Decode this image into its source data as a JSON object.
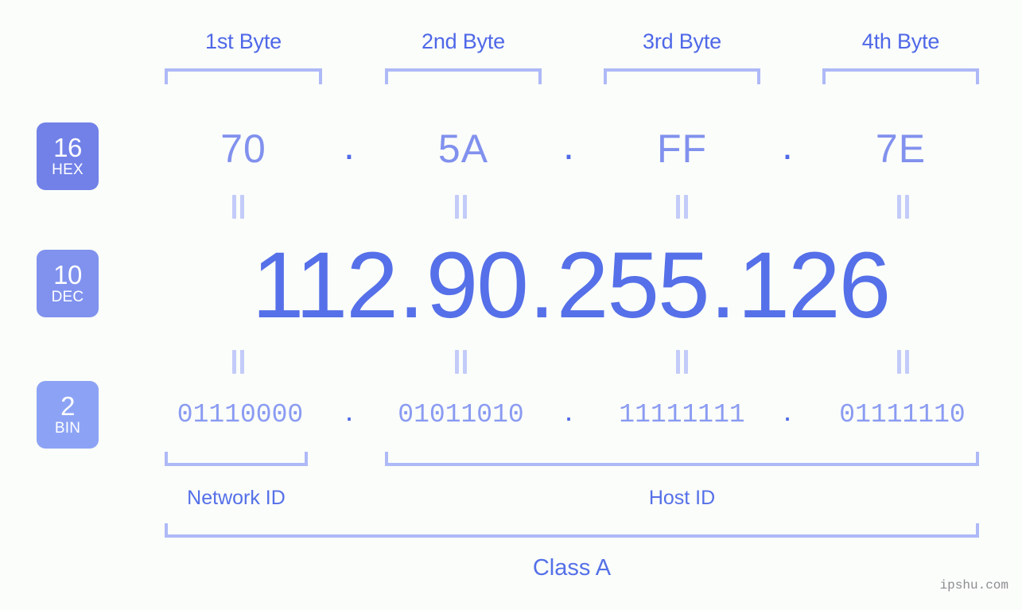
{
  "watermark": "ipshu.com",
  "background_color": "#fbfdfa",
  "colors": {
    "hex_text": "#8191ee",
    "dec_text": "#5570e8",
    "bin_text": "#8a9bf2",
    "bracket": "#aeb9f7",
    "equals": "#c3cbf9",
    "label": "#4f68e8",
    "badge_hex": "#7181e8",
    "badge_dec": "#8092ee",
    "badge_bin": "#8ca3f5",
    "watermark": "#8d8d93"
  },
  "byte_headers": [
    {
      "label": "1st Byte"
    },
    {
      "label": "2nd Byte"
    },
    {
      "label": "3rd Byte"
    },
    {
      "label": "4th Byte"
    }
  ],
  "rows": {
    "hex": {
      "badge_number": "16",
      "badge_system": "HEX",
      "values": [
        "70",
        "5A",
        "FF",
        "7E"
      ],
      "separator": "."
    },
    "dec": {
      "badge_number": "10",
      "badge_system": "DEC",
      "values": [
        "112",
        "90",
        "255",
        "126"
      ],
      "separator": "."
    },
    "bin": {
      "badge_number": "2",
      "badge_system": "BIN",
      "values": [
        "01110000",
        "01011010",
        "11111111",
        "01111110"
      ],
      "separator": "."
    }
  },
  "equals_symbol": "=",
  "segments": {
    "network_id": "Network ID",
    "host_id": "Host ID",
    "class": "Class A"
  }
}
